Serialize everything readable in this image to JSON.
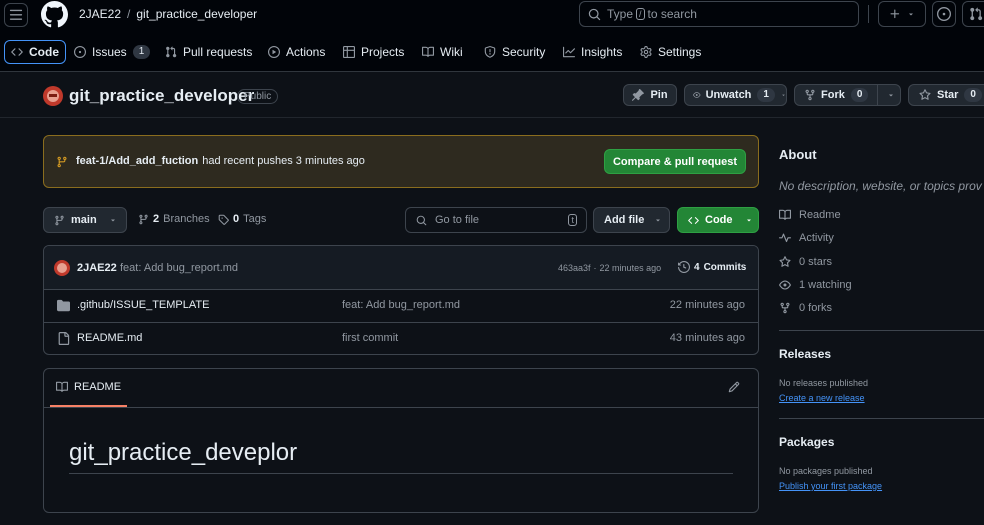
{
  "header": {
    "owner": "2JAE22",
    "separator": "/",
    "repo": "git_practice_developer",
    "search_prefix": "Type",
    "search_key": "/",
    "search_suffix": "to search"
  },
  "nav": {
    "code": "Code",
    "issues": "Issues",
    "issues_count": "1",
    "pulls": "Pull requests",
    "actions": "Actions",
    "projects": "Projects",
    "wiki": "Wiki",
    "security": "Security",
    "insights": "Insights",
    "settings": "Settings"
  },
  "repo_head": {
    "name": "git_practice_developer",
    "visibility": "Public",
    "pin": "Pin",
    "unwatch": "Unwatch",
    "unwatch_count": "1",
    "fork": "Fork",
    "fork_count": "0",
    "star": "Star",
    "star_count": "0"
  },
  "banner": {
    "branch": "feat-1/Add_add_fuction",
    "message": "had recent pushes 3 minutes ago",
    "button": "Compare & pull request"
  },
  "toolbar": {
    "branch": "main",
    "branches_count": "2",
    "branches_label": "Branches",
    "tags_count": "0",
    "tags_label": "Tags",
    "goto_placeholder": "Go to file",
    "goto_key": "t",
    "add_file": "Add file",
    "code": "Code"
  },
  "commit": {
    "author": "2JAE22",
    "message": "feat: Add bug_report.md",
    "hash": "463aa3f",
    "dot": "·",
    "time": "22 minutes ago",
    "commits_count": "4",
    "commits_label": "Commits"
  },
  "files": [
    {
      "name": ".github/ISSUE_TEMPLATE",
      "message": "feat: Add bug_report.md",
      "time": "22 minutes ago",
      "icon": "folder-icon"
    },
    {
      "name": "README.md",
      "message": "first commit",
      "time": "43 minutes ago",
      "icon": "file-icon"
    }
  ],
  "readme": {
    "tab": "README",
    "heading": "git_practice_deveplor"
  },
  "about": {
    "title": "About",
    "description": "No description, website, or topics prov",
    "readme": "Readme",
    "activity": "Activity",
    "stars": "0 stars",
    "watching": "1 watching",
    "forks": "0 forks"
  },
  "releases": {
    "title": "Releases",
    "empty": "No releases published",
    "link": "Create a new release"
  },
  "packages": {
    "title": "Packages",
    "empty": "No packages published",
    "link": "Publish your first package"
  },
  "colors": {
    "bg": "#0d1117",
    "header_bg": "#010409",
    "border": "#3d444d",
    "accent": "#4493f8",
    "green": "#238636",
    "banner_bg": "#2e2a1f",
    "banner_border": "#8a6d1e",
    "active_underline": "#f78166"
  }
}
